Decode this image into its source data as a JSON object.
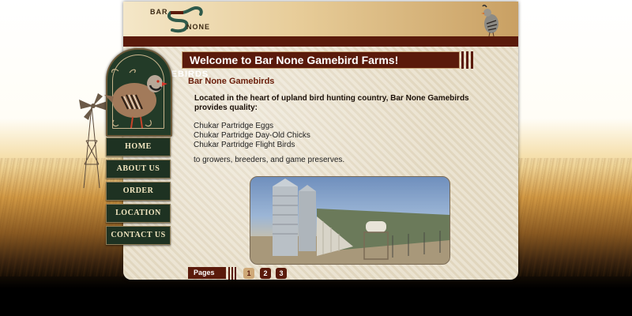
{
  "brand": {
    "logo_top": "BAR",
    "logo_bottom": "NONE",
    "logo_sub": "GAMEBIRDS"
  },
  "nav": {
    "items": [
      {
        "label": "HOME"
      },
      {
        "label": "ABOUT US"
      },
      {
        "label": "ORDER"
      },
      {
        "label": "LOCATION"
      },
      {
        "label": "CONTACT US"
      }
    ]
  },
  "main": {
    "title": "Welcome to Bar None Gamebird Farms!",
    "subtitle": "Bar None Gamebirds",
    "intro": "Located in the heart of upland bird hunting country, Bar None Gamebirds provides quality:",
    "products": [
      "Chukar Partridge Eggs",
      "Chukar Partridge Day-Old Chicks",
      "Chukar Partridge Flight Birds"
    ],
    "outro": "to growers, breeders, and game preserves."
  },
  "pager": {
    "label": "Pages",
    "pages": [
      "1",
      "2",
      "3"
    ],
    "current": "1"
  },
  "colors": {
    "brand_dark_red": "#5a1a0b",
    "nav_green": "#1e3222",
    "panel_beige": "#e9e0cc"
  },
  "icons": {
    "logo": "bar-none-s-logo-icon",
    "header_bird": "quail-icon",
    "sidebar_bird": "chukar-partridge-icon",
    "windmill": "windmill-icon",
    "photo": "farm-silo-photo"
  }
}
